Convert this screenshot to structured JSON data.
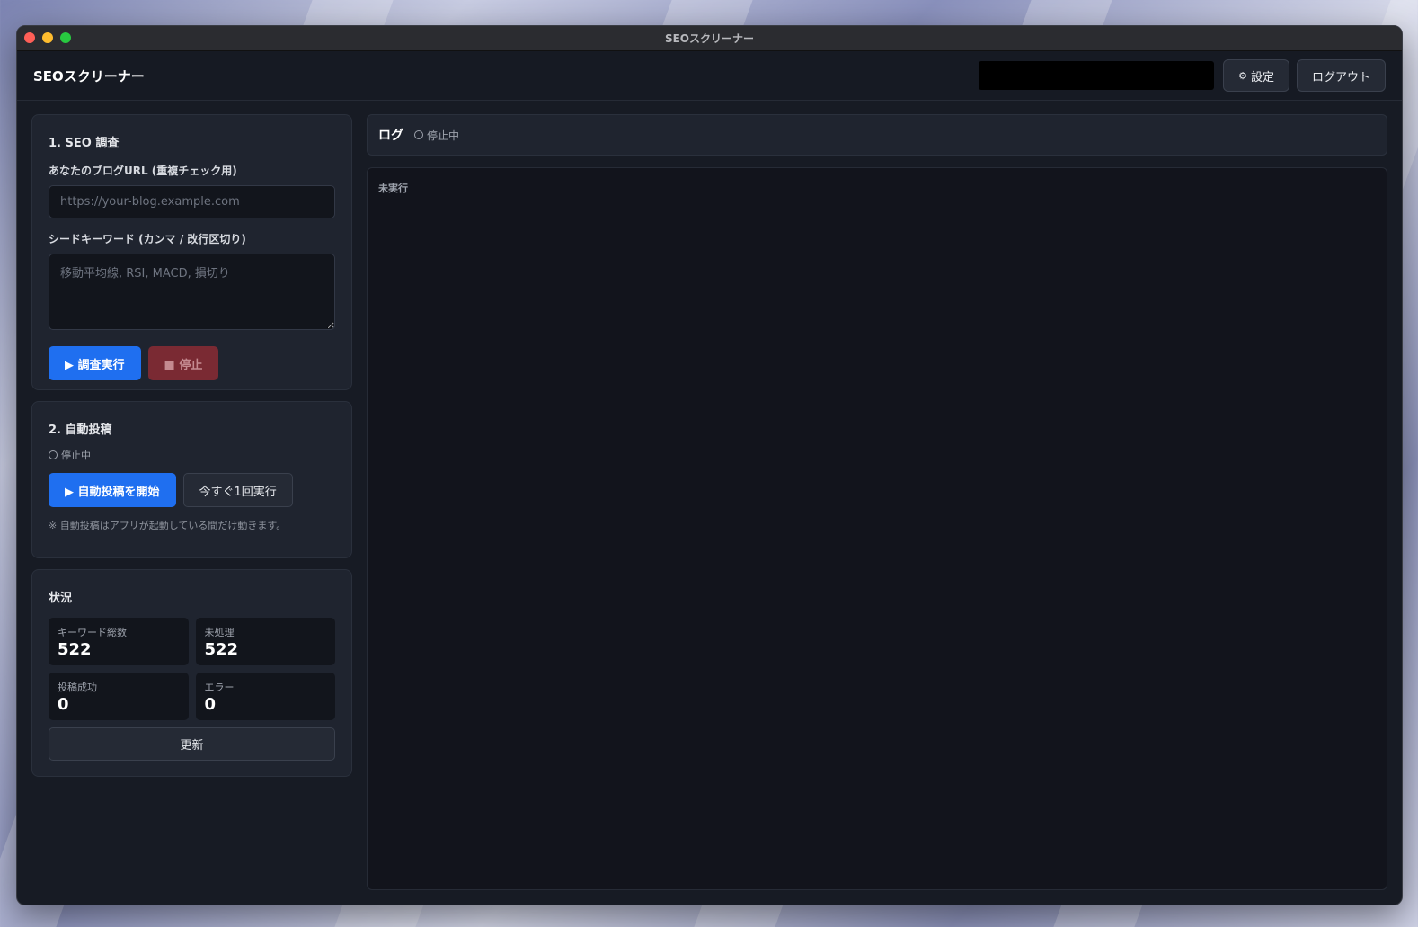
{
  "window": {
    "title": "SEOスクリーナー"
  },
  "header": {
    "app_title": "SEOスクリーナー",
    "settings_label": "設定",
    "logout_label": "ログアウト"
  },
  "research": {
    "title": "1. SEO 調査",
    "url_label": "あなたのブログURL (重複チェック用)",
    "url_placeholder": "https://your-blog.example.com",
    "url_value": "",
    "keywords_label": "シードキーワード (カンマ / 改行区切り)",
    "keywords_placeholder": "移動平均線, RSI, MACD, 損切り",
    "keywords_value": "",
    "run_label": "▶ 調査実行",
    "stop_label": "■ 停止"
  },
  "autopost": {
    "title": "2. 自動投稿",
    "status": "停止中",
    "start_label": "▶ 自動投稿を開始",
    "run_once_label": "今すぐ1回実行",
    "note": "※ 自動投稿はアプリが起動している間だけ動きます。"
  },
  "status_panel": {
    "title": "状況",
    "stats": [
      {
        "label": "キーワード総数",
        "value": "522"
      },
      {
        "label": "未処理",
        "value": "522"
      },
      {
        "label": "投稿成功",
        "value": "0"
      },
      {
        "label": "エラー",
        "value": "0"
      }
    ],
    "refresh_label": "更新"
  },
  "log": {
    "title": "ログ",
    "status": "停止中",
    "content": "未実行"
  },
  "colors": {
    "accent": "#1f6ff0",
    "stop": "#7a2a33",
    "background": "#171b24"
  }
}
